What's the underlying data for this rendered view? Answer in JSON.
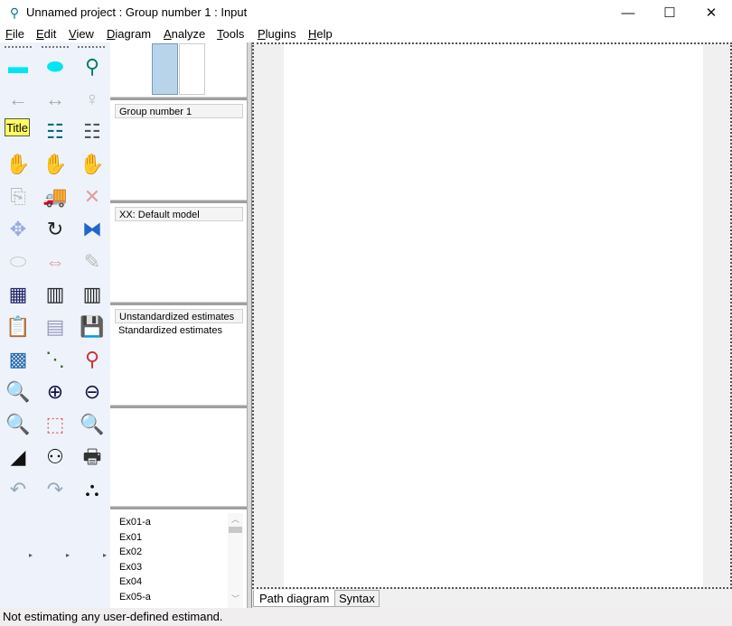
{
  "window": {
    "title": "Unnamed project : Group number 1 : Input",
    "minimize": "—",
    "maximize": "☐",
    "close": "✕"
  },
  "menu": [
    {
      "label": "File",
      "key": "F",
      "rest": "ile"
    },
    {
      "label": "Edit",
      "key": "E",
      "rest": "dit"
    },
    {
      "label": "View",
      "key": "V",
      "rest": "iew"
    },
    {
      "label": "Diagram",
      "key": "D",
      "rest": "iagram"
    },
    {
      "label": "Analyze",
      "key": "A",
      "rest": "nalyze"
    },
    {
      "label": "Tools",
      "key": "T",
      "rest": "ools"
    },
    {
      "label": "Plugins",
      "key": "P",
      "rest": "lugins"
    },
    {
      "label": "Help",
      "key": "H",
      "rest": "elp"
    }
  ],
  "toolbox": [
    {
      "icon": "rectangle-icon",
      "glyph": "▬",
      "color": "#00e5f0"
    },
    {
      "icon": "ellipse-icon",
      "glyph": "⬬",
      "color": "#00e5f0"
    },
    {
      "icon": "indicator-icon",
      "glyph": "⚲",
      "color": "#0a7a6a"
    },
    {
      "icon": "single-arrow-icon",
      "glyph": "←",
      "color": "#aaa"
    },
    {
      "icon": "double-arrow-icon",
      "glyph": "↔",
      "color": "#aaa"
    },
    {
      "icon": "unique-variable-icon",
      "glyph": "♀",
      "color": "#bbb"
    },
    {
      "icon": "title-icon",
      "glyph": "Title",
      "color": "#000"
    },
    {
      "icon": "list-model-variables-icon",
      "glyph": "☷",
      "color": "#0a6a7a"
    },
    {
      "icon": "list-dataset-variables-icon",
      "glyph": "☷",
      "color": "#555"
    },
    {
      "icon": "select-one-icon",
      "glyph": "✋",
      "color": "#ccc"
    },
    {
      "icon": "select-all-icon",
      "glyph": "✋",
      "color": "#ccc"
    },
    {
      "icon": "deselect-all-icon",
      "glyph": "✋",
      "color": "#ccc"
    },
    {
      "icon": "duplicate-icon",
      "glyph": "⎘",
      "color": "#bbb"
    },
    {
      "icon": "move-icon",
      "glyph": "🚚",
      "color": "#c00"
    },
    {
      "icon": "erase-icon",
      "glyph": "✕",
      "color": "#e0a0a0"
    },
    {
      "icon": "change-shape-icon",
      "glyph": "✥",
      "color": "#9ad"
    },
    {
      "icon": "rotate-icon",
      "glyph": "↻",
      "color": "#222"
    },
    {
      "icon": "reflect-icon",
      "glyph": "⧓",
      "color": "#26c"
    },
    {
      "icon": "move-parameters-icon",
      "glyph": "⬭",
      "color": "#ccc"
    },
    {
      "icon": "scroll-icon",
      "glyph": "⇔",
      "color": "#e0a0a0"
    },
    {
      "icon": "touch-up-icon",
      "glyph": "✎",
      "color": "#bbb"
    },
    {
      "icon": "select-data-files-icon",
      "glyph": "▦",
      "color": "#226"
    },
    {
      "icon": "analysis-properties-icon",
      "glyph": "▥",
      "color": "#222"
    },
    {
      "icon": "calculate-estimates-icon",
      "glyph": "▥",
      "color": "#222"
    },
    {
      "icon": "copy-to-clipboard-icon",
      "glyph": "📋",
      "color": "#a60"
    },
    {
      "icon": "view-text-icon",
      "glyph": "▤",
      "color": "#99b"
    },
    {
      "icon": "save-icon",
      "glyph": "💾",
      "color": "#222"
    },
    {
      "icon": "object-properties-icon",
      "glyph": "▩",
      "color": "#26a"
    },
    {
      "icon": "drag-properties-icon",
      "glyph": "⋱",
      "color": "#363"
    },
    {
      "icon": "preserve-symmetries-icon",
      "glyph": "⚲",
      "color": "#c33"
    },
    {
      "icon": "zoom-area-icon",
      "glyph": "🔍",
      "color": "#a60"
    },
    {
      "icon": "zoom-in-icon",
      "glyph": "⊕",
      "color": "#114"
    },
    {
      "icon": "zoom-out-icon",
      "glyph": "⊖",
      "color": "#114"
    },
    {
      "icon": "view-page-icon",
      "glyph": "🔍",
      "color": "#333"
    },
    {
      "icon": "fit-to-page-icon",
      "glyph": "⬚",
      "color": "#d66"
    },
    {
      "icon": "loupe-icon",
      "glyph": "🔍",
      "color": "#aa0"
    },
    {
      "icon": "bayesian-icon",
      "glyph": "◢",
      "color": "#111"
    },
    {
      "icon": "multiple-group-icon",
      "glyph": "⚇",
      "color": "#111"
    },
    {
      "icon": "print-icon",
      "glyph": "🖶",
      "color": "#333"
    },
    {
      "icon": "undo-icon",
      "glyph": "↶",
      "color": "#9ab"
    },
    {
      "icon": "redo-icon",
      "glyph": "↷",
      "color": "#9ab"
    },
    {
      "icon": "specification-search-icon",
      "glyph": "⛬",
      "color": "#111"
    }
  ],
  "panels": {
    "group": "Group number 1",
    "model": "XX: Default model",
    "estimates": [
      "Unstandardized estimates",
      "Standardized estimates"
    ],
    "files": [
      "Ex01-a",
      "Ex01",
      "Ex02",
      "Ex03",
      "Ex04",
      "Ex05-a"
    ]
  },
  "tabs": {
    "path_diagram": "Path diagram",
    "syntax": "Syntax"
  },
  "status": "Not estimating any user-defined estimand."
}
